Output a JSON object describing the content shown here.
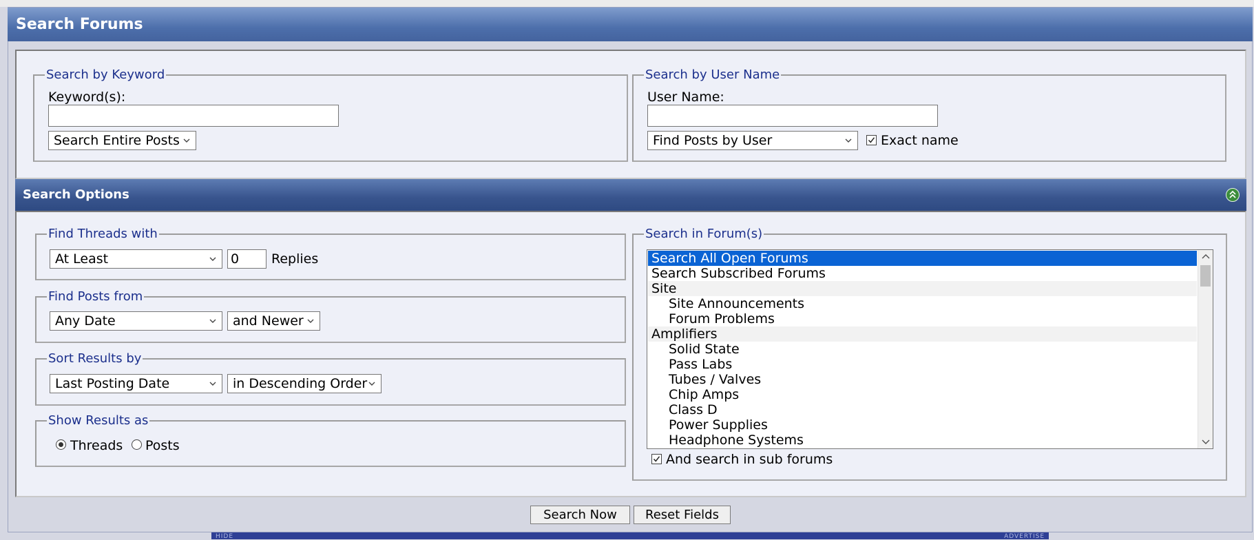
{
  "title": "Search Forums",
  "keyword_section": {
    "legend": "Search by Keyword",
    "label": "Keyword(s):",
    "value": "",
    "mode_select": "Search Entire Posts"
  },
  "user_section": {
    "legend": "Search by User Name",
    "label": "User Name:",
    "value": "",
    "mode_select": "Find Posts by User",
    "exact_name_label": "Exact name",
    "exact_name_checked": true
  },
  "options_bar": {
    "title": "Search Options",
    "collapse_icon": "collapse-up-icon"
  },
  "find_threads": {
    "legend": "Find Threads with",
    "comparator": "At Least",
    "count": "0",
    "suffix": "Replies"
  },
  "find_posts": {
    "legend": "Find Posts from",
    "date": "Any Date",
    "direction": "and Newer"
  },
  "sort_results": {
    "legend": "Sort Results by",
    "field": "Last Posting Date",
    "order": "in Descending Order"
  },
  "show_results": {
    "legend": "Show Results as",
    "option_threads": "Threads",
    "option_posts": "Posts",
    "selected": "Threads"
  },
  "forums": {
    "legend": "Search in Forum(s)",
    "items": [
      {
        "label": "Search All Open Forums",
        "indent": false,
        "group": false,
        "selected": true
      },
      {
        "label": "Search Subscribed Forums",
        "indent": false,
        "group": false,
        "selected": false
      },
      {
        "label": "Site",
        "indent": false,
        "group": true,
        "selected": false
      },
      {
        "label": "Site Announcements",
        "indent": true,
        "group": false,
        "selected": false
      },
      {
        "label": "Forum Problems",
        "indent": true,
        "group": false,
        "selected": false
      },
      {
        "label": "Amplifiers",
        "indent": false,
        "group": true,
        "selected": false
      },
      {
        "label": "Solid State",
        "indent": true,
        "group": false,
        "selected": false
      },
      {
        "label": "Pass Labs",
        "indent": true,
        "group": false,
        "selected": false
      },
      {
        "label": "Tubes / Valves",
        "indent": true,
        "group": false,
        "selected": false
      },
      {
        "label": "Chip Amps",
        "indent": true,
        "group": false,
        "selected": false
      },
      {
        "label": "Class D",
        "indent": true,
        "group": false,
        "selected": false
      },
      {
        "label": "Power Supplies",
        "indent": true,
        "group": false,
        "selected": false
      },
      {
        "label": "Headphone Systems",
        "indent": true,
        "group": false,
        "selected": false
      }
    ],
    "subforums_label": "And search in sub forums",
    "subforums_checked": true
  },
  "buttons": {
    "search": "Search Now",
    "reset": "Reset Fields"
  },
  "footer": {
    "left": "HIDE",
    "right": "ADVERTISE"
  },
  "colors": {
    "title_bar": "#4d6fab",
    "options_bar": "#38548d",
    "legend_text": "#1b2f8c",
    "selected_item": "#0a63d4"
  }
}
